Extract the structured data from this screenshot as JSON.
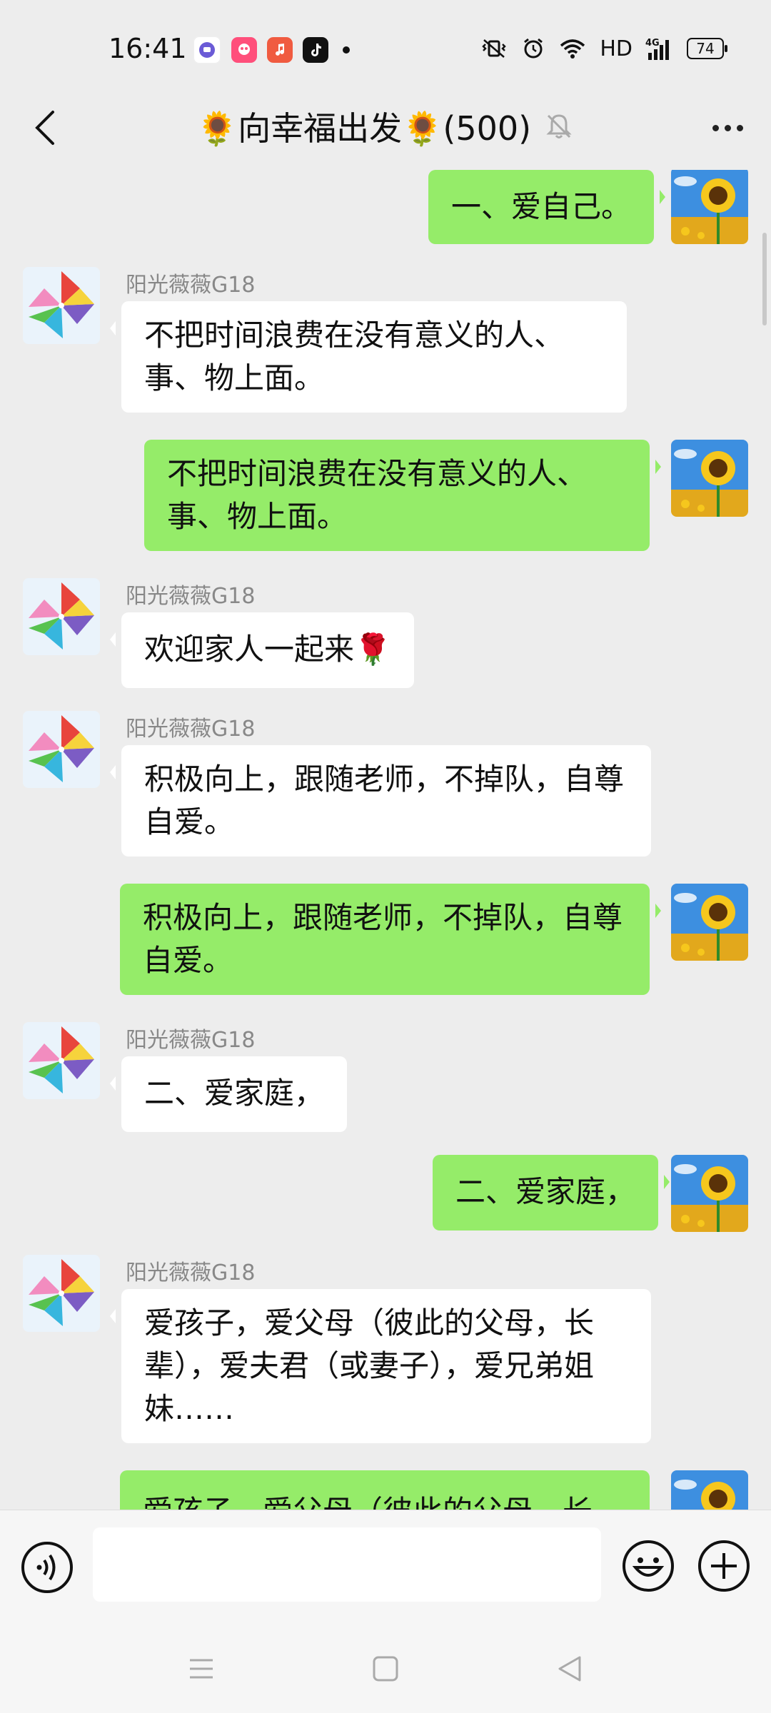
{
  "status": {
    "time": "16:41",
    "network": "HD",
    "signal_label": "4G",
    "battery": "74"
  },
  "header": {
    "title": "🌻向幸福出发🌻(500)"
  },
  "messages": [
    {
      "dir": "out",
      "text": "一、爱自己。"
    },
    {
      "dir": "in",
      "sender": "阳光薇薇G18",
      "text": "不把时间浪费在没有意义的人、事、物上面。"
    },
    {
      "dir": "out",
      "text": "不把时间浪费在没有意义的人、事、物上面。"
    },
    {
      "dir": "in",
      "sender": "阳光薇薇G18",
      "text": "欢迎家人一起来🌹"
    },
    {
      "dir": "in",
      "sender": "阳光薇薇G18",
      "text": "积极向上，跟随老师，不掉队，自尊自爱。"
    },
    {
      "dir": "out",
      "text": "积极向上，跟随老师，不掉队，自尊自爱。"
    },
    {
      "dir": "in",
      "sender": "阳光薇薇G18",
      "text": "二、爱家庭，"
    },
    {
      "dir": "out",
      "text": "二、爱家庭，"
    },
    {
      "dir": "in",
      "sender": "阳光薇薇G18",
      "text": "爱孩子，爱父母（彼此的父母，长辈），爱夫君（或妻子），爱兄弟姐妹……"
    },
    {
      "dir": "out",
      "text": "爱孩子，爱父母（彼此的父母，长"
    }
  ],
  "input": {
    "value": ""
  },
  "icons": {
    "back": "back-arrow-icon",
    "mute": "mute-bell-icon",
    "more": "more-icon",
    "voice": "voice-icon",
    "emoji": "emoji-icon",
    "plus": "plus-icon"
  }
}
